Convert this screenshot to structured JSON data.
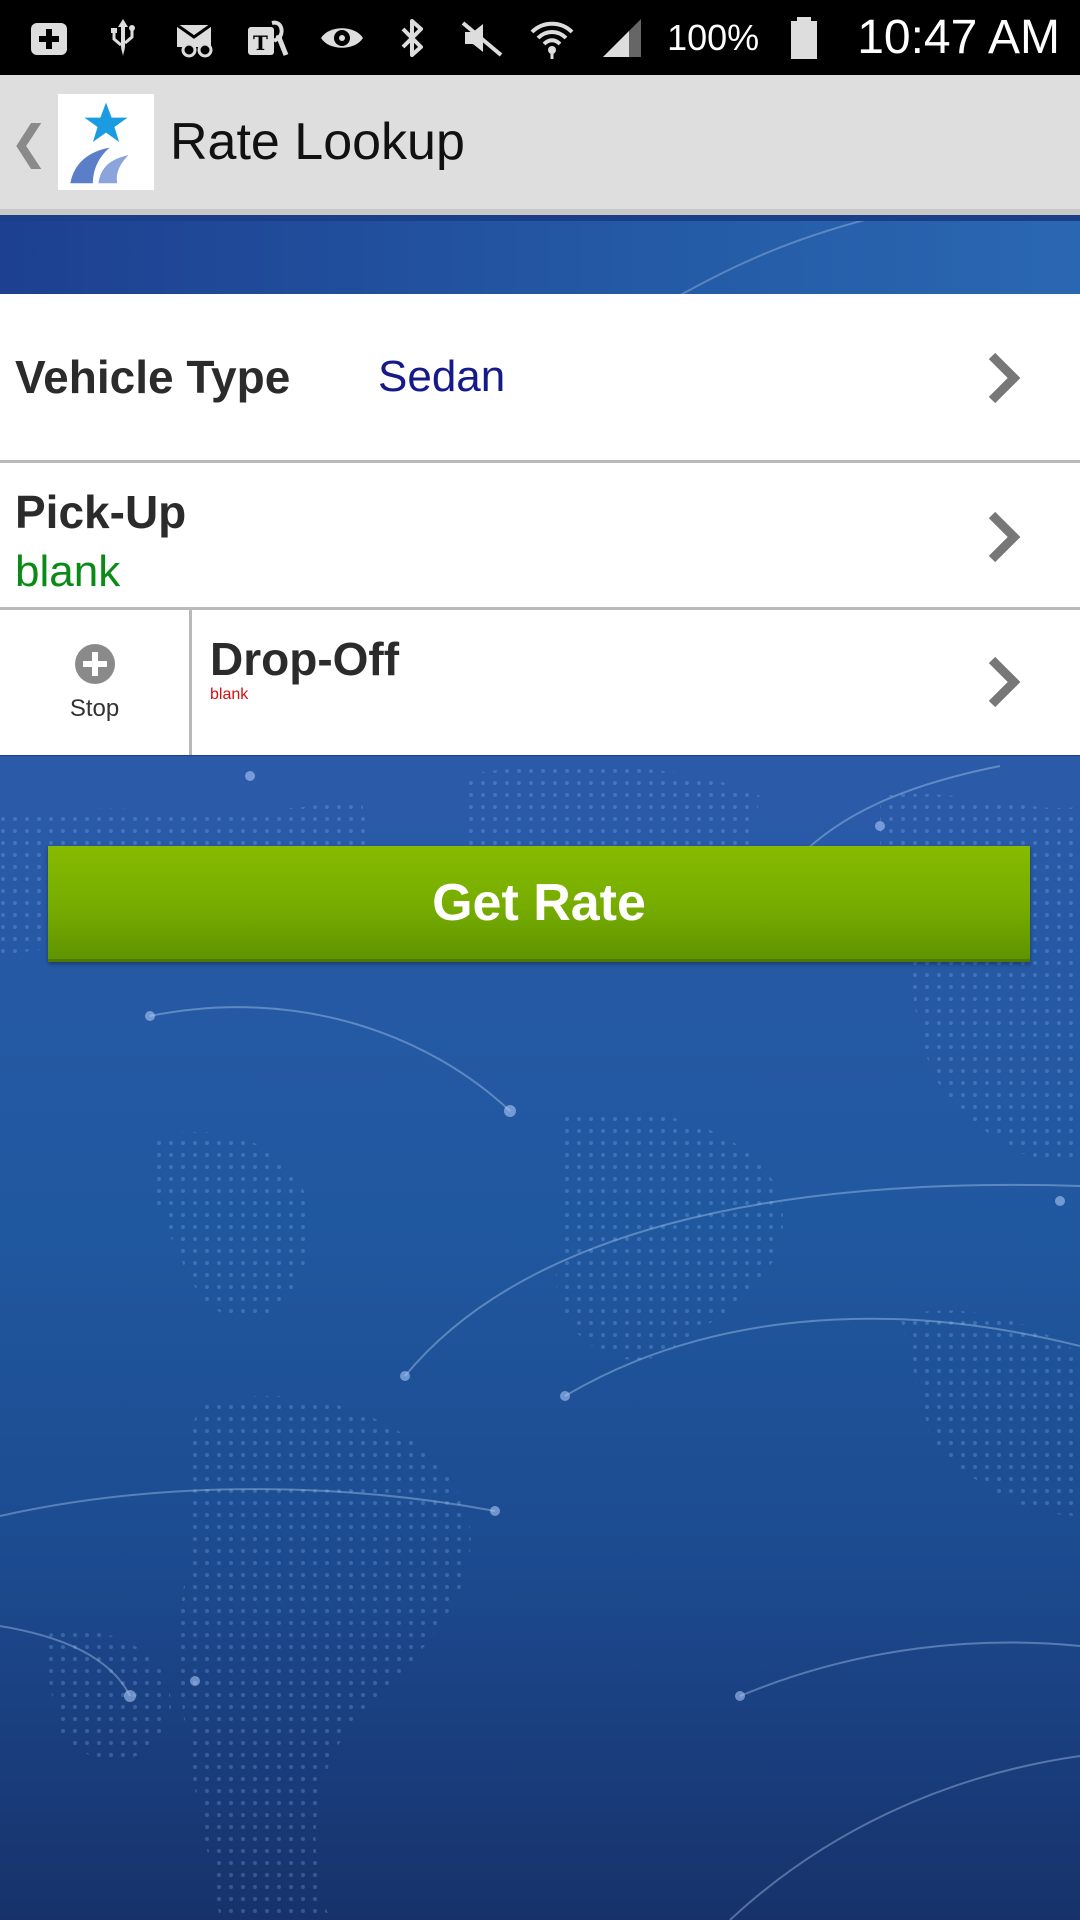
{
  "status_bar": {
    "battery_percent": "100%",
    "time": "10:47 AM",
    "icons": [
      "add-box-icon",
      "usb-icon",
      "voicemail-icon",
      "tmobile-icon",
      "eye-icon",
      "bluetooth-icon",
      "mute-icon",
      "wifi-icon",
      "signal-icon",
      "battery-icon"
    ]
  },
  "action_bar": {
    "title": "Rate Lookup",
    "back_glyph": "❮"
  },
  "form": {
    "vehicle_type": {
      "label": "Vehicle Type",
      "value": "Sedan",
      "value_color": "#141a8a"
    },
    "pickup": {
      "label": "Pick-Up",
      "value": "blank",
      "value_color": "#0a8a16"
    },
    "dropoff": {
      "label": "Drop-Off",
      "value": "blank",
      "value_color": "#d40f0f"
    },
    "stop": {
      "label": "Stop"
    }
  },
  "get_rate_button": {
    "label": "Get Rate",
    "color": "#76ac00"
  }
}
